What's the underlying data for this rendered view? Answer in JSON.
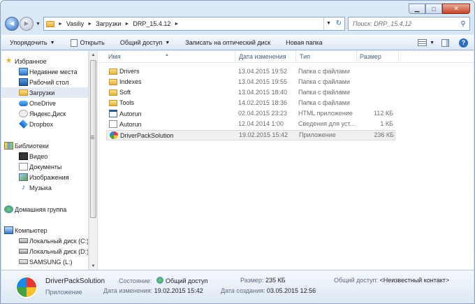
{
  "window": {
    "caption": {
      "minimize": "▁",
      "maximize": "□",
      "close": "✕"
    }
  },
  "nav": {
    "back": "◄",
    "forward": "►",
    "history_drop": "▼",
    "breadcrumbs": [
      "Vasiliy",
      "Загрузки",
      "DRP_15.4.12"
    ],
    "refresh": "↻",
    "search_placeholder": "Поиск: DRP_15.4.12",
    "search_icon": "⚲"
  },
  "toolbar": {
    "organize": "Упорядочить",
    "open": "Открыть",
    "share": "Общий доступ",
    "burn": "Записать на оптический диск",
    "new_folder": "Новая папка",
    "help": "?",
    "dropdown_arrow": "▼"
  },
  "sidebar": {
    "items": [
      {
        "label": "Избранное",
        "icon": "star-icon"
      },
      {
        "label": "Недавние места",
        "icon": "recent-places-icon"
      },
      {
        "label": "Рабочий стол",
        "icon": "desktop-icon"
      },
      {
        "label": "Загрузки",
        "icon": "downloads-icon"
      },
      {
        "label": "OneDrive",
        "icon": "onedrive-icon"
      },
      {
        "label": "Яндекс.Диск",
        "icon": "yandex-disk-icon"
      },
      {
        "label": "Dropbox",
        "icon": "dropbox-icon"
      },
      {
        "label": "Библиотеки",
        "icon": "libraries-icon"
      },
      {
        "label": "Видео",
        "icon": "video-icon"
      },
      {
        "label": "Документы",
        "icon": "documents-icon"
      },
      {
        "label": "Изображения",
        "icon": "images-icon"
      },
      {
        "label": "Музыка",
        "icon": "music-icon"
      },
      {
        "label": "Домашняя группа",
        "icon": "homegroup-icon"
      },
      {
        "label": "Компьютер",
        "icon": "computer-icon"
      },
      {
        "label": "Локальный диск (C:)",
        "icon": "drive-icon"
      },
      {
        "label": "Локальный диск (D:)",
        "icon": "drive-icon"
      },
      {
        "label": "SAMSUNG (L:)",
        "icon": "usb-drive-icon"
      }
    ]
  },
  "columns": {
    "name": "Имя",
    "date": "Дата изменения",
    "type": "Тип",
    "size": "Размер",
    "sort_indicator": "▲"
  },
  "files": [
    {
      "name": "Drivers",
      "date": "13.04.2015 19:52",
      "type": "Папка с файлами",
      "size": "",
      "icon": "folder-icon"
    },
    {
      "name": "Indexes",
      "date": "13.04.2015 19:55",
      "type": "Папка с файлами",
      "size": "",
      "icon": "folder-icon"
    },
    {
      "name": "Soft",
      "date": "13.04.2015 18:40",
      "type": "Папка с файлами",
      "size": "",
      "icon": "folder-icon"
    },
    {
      "name": "Tools",
      "date": "14.02.2015 18:36",
      "type": "Папка с файлами",
      "size": "",
      "icon": "folder-icon"
    },
    {
      "name": "Autorun",
      "date": "02.04.2015 23:23",
      "type": "HTML приложение",
      "size": "112 КБ",
      "icon": "hta-file-icon"
    },
    {
      "name": "Autorun",
      "date": "12.04.2014 1:00",
      "type": "Сведения для уст...",
      "size": "1 КБ",
      "icon": "inf-file-icon"
    },
    {
      "name": "DriverPackSolution",
      "date": "19.02.2015 15:42",
      "type": "Приложение",
      "size": "236 КБ",
      "icon": "app-icon"
    }
  ],
  "details": {
    "name": "DriverPackSolution",
    "kind": "Приложение",
    "state_label": "Состояние:",
    "state_value": "Общий доступ",
    "modified_label": "Дата изменения:",
    "modified_value": "19.02.2015 15:42",
    "size_label": "Размер:",
    "size_value": "235 КБ",
    "created_label": "Дата создания:",
    "created_value": "03.05.2015 12:56",
    "shared_label": "Общий доступ:",
    "shared_value": "<Неизвестный контакт>"
  }
}
